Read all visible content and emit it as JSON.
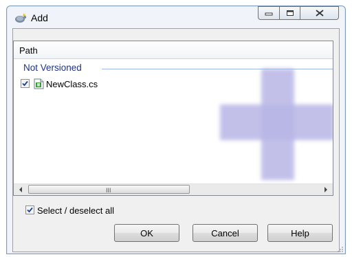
{
  "window": {
    "title": "Add",
    "icon": "tortoise-svn-add-icon",
    "controls": [
      "minimize-icon",
      "maximize-icon",
      "close-icon"
    ]
  },
  "list": {
    "column_header": "Path",
    "group_label": "Not Versioned",
    "items": [
      {
        "checked": true,
        "icon": "csharp-file-icon",
        "name": "NewClass.cs"
      }
    ],
    "watermark_icon": "plus-icon",
    "scroll_grip": "III"
  },
  "select_all": {
    "checked": true,
    "label": "Select / deselect all"
  },
  "buttons": {
    "ok": "OK",
    "cancel": "Cancel",
    "help": "Help"
  },
  "colors": {
    "group_label": "#1e3287",
    "watermark": "#b8b6e6",
    "window_border": "#7f9db9"
  }
}
